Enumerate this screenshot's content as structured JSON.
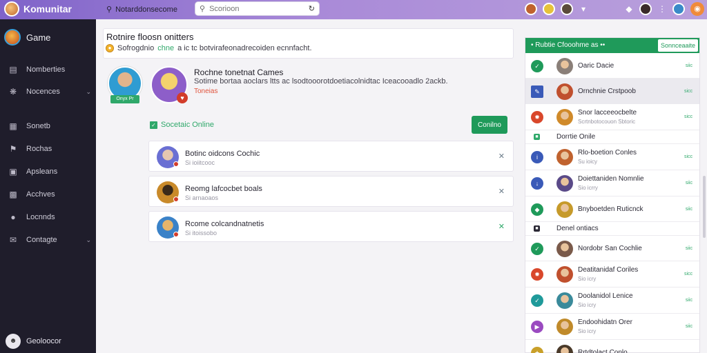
{
  "topbar": {
    "brand": "Komunitar",
    "section_label": "Notarddonsecome",
    "search_placeholder": "Scorioon"
  },
  "sidebar": {
    "game_label": "Game",
    "items": [
      {
        "label": "Nomberties",
        "icon": "document-icon",
        "chevron": false
      },
      {
        "label": "Nocences",
        "icon": "group-icon",
        "chevron": true
      },
      {
        "label": "Sonetb",
        "icon": "bookmark-icon",
        "chevron": false
      },
      {
        "label": "Rochas",
        "icon": "flag-icon",
        "chevron": false
      },
      {
        "label": "Apsleans",
        "icon": "folder-icon",
        "chevron": false
      },
      {
        "label": "Acchves",
        "icon": "archive-icon",
        "chevron": false
      },
      {
        "label": "Locnnds",
        "icon": "location-icon",
        "chevron": false
      },
      {
        "label": "Contagte",
        "icon": "mail-icon",
        "chevron": true
      }
    ],
    "user_label": "Geoloocor"
  },
  "notice": {
    "title": "Rotnire floosn onitters",
    "text_pre": "Sofrogdnio",
    "text_highlight": "chne",
    "text_post": "a ic tc botvirafeonadrecoiden ecnnfacht."
  },
  "game": {
    "title": "Rochne tonetnat Cames",
    "description": "Sotime bortaa aoclars ltts ac lsodtooorotdoetiacolnidtac Iceacooadlo 2ackb.",
    "link": "Toneias",
    "hero1_badge": "Onyx Pr"
  },
  "online": {
    "heading": "Socetaic Online",
    "button": "Conilno",
    "members": [
      {
        "name": "Botinc oidcons Cochic",
        "sub": "Si ioiitcooc",
        "color": "#6a6fd3"
      },
      {
        "name": "Reomg lafcocbet boals",
        "sub": "Si arnaoaos",
        "color": "#c98a2a"
      },
      {
        "name": "Rcome colcandnatnetis",
        "sub": "Si itoissobo",
        "color": "#3a82c8"
      }
    ]
  },
  "friends": {
    "header": "Rubtie Cfooohme as",
    "header_button": "Sonnceaaite",
    "groups": [
      {
        "label": "",
        "rows": [
          {
            "name": "Oaric Dacie",
            "sub": "",
            "time": "siic",
            "icon_color": "#1f9a5a",
            "icon": "check-icon",
            "avatar": "#8a7f78",
            "selected": false
          },
          {
            "name": "Ornchnie Crstpoob",
            "sub": "",
            "time": "sicc",
            "icon_color": "#3a5ab8",
            "icon": "edit-icon",
            "avatar": "#c0502e",
            "selected": true
          },
          {
            "name": "Snor lacceeocbelte",
            "sub": "Scrtnbotocouon Sbtoric",
            "time": "sicc",
            "icon_color": "#d9472b",
            "icon": "fire-icon",
            "avatar": "#d08a2a",
            "selected": false
          }
        ]
      },
      {
        "label": "Dorrtie Onile",
        "sq_color": "#2fa86a",
        "rows": [
          {
            "name": "Rlo-boetion Conles",
            "sub": "Su ioicy",
            "time": "sicc",
            "icon_color": "#3a5ab8",
            "icon": "info-icon",
            "avatar": "#c0622e",
            "selected": false
          },
          {
            "name": "Doiettaniden Nomnlie",
            "sub": "Sio icrry",
            "time": "siic",
            "icon_color": "#3a5ab8",
            "icon": "arrow-down-icon",
            "avatar": "#5a4a88",
            "selected": false
          },
          {
            "name": "Bnyboetden Ruticnck",
            "sub": "",
            "time": "siic",
            "icon_color": "#1f9a5a",
            "icon": "shield-icon",
            "avatar": "#c69a2a",
            "selected": false
          }
        ]
      },
      {
        "label": "Denel ontiacs",
        "sq_color": "#2b2935",
        "rows": [
          {
            "name": "Nordobr San Cochlie",
            "sub": "",
            "time": "siic",
            "icon_color": "#1f9a5a",
            "icon": "check-icon",
            "avatar": "#7a5a4a",
            "selected": false
          },
          {
            "name": "Deatitanidaf Coriles",
            "sub": "Sio icry",
            "time": "sicc",
            "icon_color": "#d9472b",
            "icon": "fire-icon",
            "avatar": "#c0502e",
            "selected": false
          },
          {
            "name": "Doolanidol Lenice",
            "sub": "Sio icry",
            "time": "siic",
            "icon_color": "#1f9a9a",
            "icon": "check-icon",
            "avatar": "#3a8a9a",
            "selected": false
          },
          {
            "name": "Endoohidatn Orer",
            "sub": "Sio icry",
            "time": "siic",
            "icon_color": "#9a4ac0",
            "icon": "play-icon",
            "avatar": "#c08a2a",
            "selected": false
          },
          {
            "name": "Rrtdtolact Conlo",
            "sub": "",
            "time": "",
            "icon_color": "#c9a02a",
            "icon": "star-icon",
            "avatar": "#4a3a2a",
            "selected": false
          }
        ]
      }
    ]
  }
}
